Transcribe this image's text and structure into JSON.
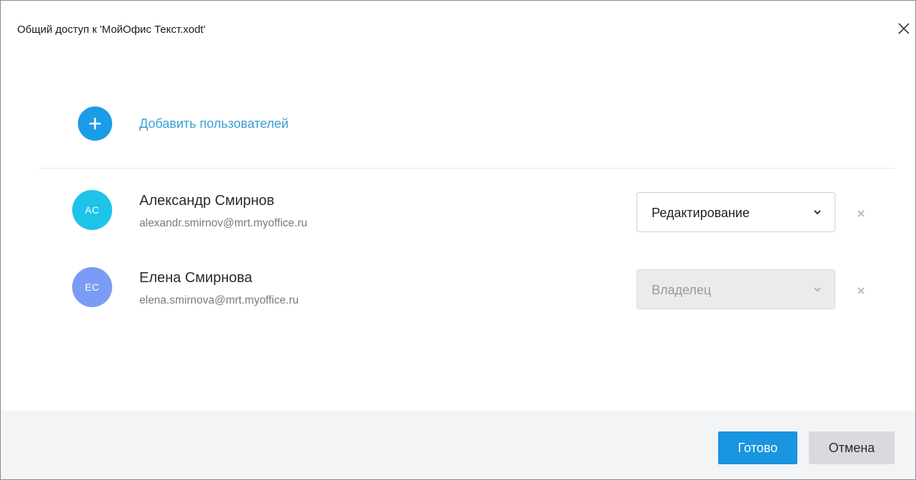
{
  "dialog": {
    "title": "Общий доступ к 'МойОфис Текст.xodt'"
  },
  "add_users": {
    "label": "Добавить пользователей"
  },
  "users": [
    {
      "initials": "AC",
      "name": "Александр Смирнов",
      "email": "alexandr.smirnov@mrt.myoffice.ru",
      "role": "Редактирование",
      "avatar_color": "#1ec3ea",
      "role_editable": true
    },
    {
      "initials": "EC",
      "name": "Елена Смирнова",
      "email": "elena.smirnova@mrt.myoffice.ru",
      "role": "Владелец",
      "avatar_color": "#7b9cf4",
      "role_editable": false
    }
  ],
  "footer": {
    "done_label": "Готово",
    "cancel_label": "Отмена"
  },
  "colors": {
    "accent": "#1a95e0",
    "link": "#3a9fd8",
    "footer_bg": "#f3f4f6"
  },
  "icons": {
    "close": "close-icon",
    "add": "plus-icon",
    "dropdown": "chevron-down-icon",
    "remove": "remove-user-icon"
  }
}
